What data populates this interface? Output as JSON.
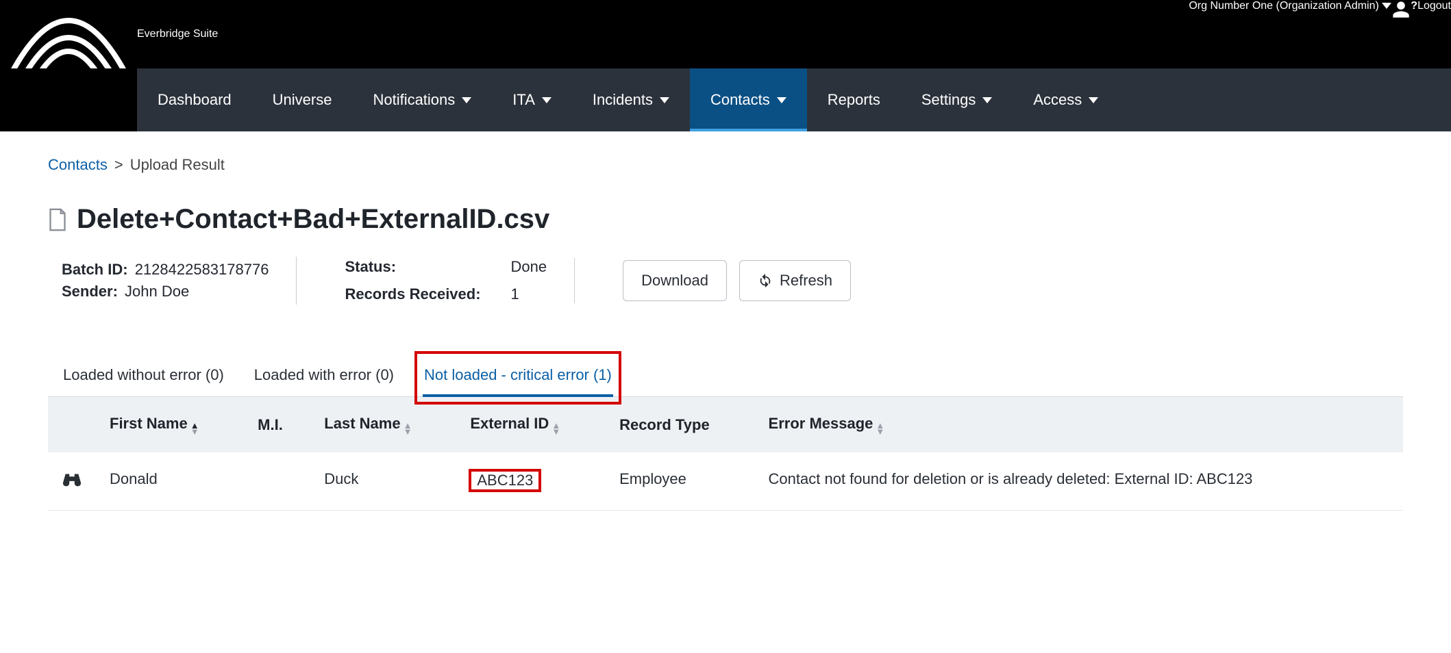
{
  "header": {
    "brand": "Everbridge Suite",
    "org_name": "Org Number One",
    "org_role": "(Organization Admin)",
    "logout": "Logout"
  },
  "nav": {
    "items": [
      {
        "label": "Dashboard",
        "dropdown": false
      },
      {
        "label": "Universe",
        "dropdown": false
      },
      {
        "label": "Notifications",
        "dropdown": true
      },
      {
        "label": "ITA",
        "dropdown": true
      },
      {
        "label": "Incidents",
        "dropdown": true
      },
      {
        "label": "Contacts",
        "dropdown": true,
        "active": true
      },
      {
        "label": "Reports",
        "dropdown": false
      },
      {
        "label": "Settings",
        "dropdown": true
      },
      {
        "label": "Access",
        "dropdown": true
      }
    ]
  },
  "breadcrumb": {
    "root": "Contacts",
    "current": "Upload Result"
  },
  "page": {
    "title": "Delete+Contact+Bad+ExternalID.csv"
  },
  "meta": {
    "batch_id_label": "Batch ID:",
    "batch_id": "2128422583178776",
    "sender_label": "Sender:",
    "sender": "John Doe",
    "status_label": "Status:",
    "status": "Done",
    "records_label": "Records Received:",
    "records": "1"
  },
  "actions": {
    "download": "Download",
    "refresh": "Refresh"
  },
  "tabs": [
    {
      "label": "Loaded without error (0)"
    },
    {
      "label": "Loaded with error (0)"
    },
    {
      "label": "Not loaded - critical error (1)",
      "active": true,
      "highlight": true
    }
  ],
  "table": {
    "columns": [
      "First Name",
      "M.I.",
      "Last Name",
      "External ID",
      "Record Type",
      "Error Message"
    ],
    "rows": [
      {
        "first_name": "Donald",
        "mi": "",
        "last_name": "Duck",
        "external_id": "ABC123",
        "record_type": "Employee",
        "error_message": "Contact not found for deletion or is already deleted: External ID: ABC123",
        "highlight_external_id": true
      }
    ]
  }
}
